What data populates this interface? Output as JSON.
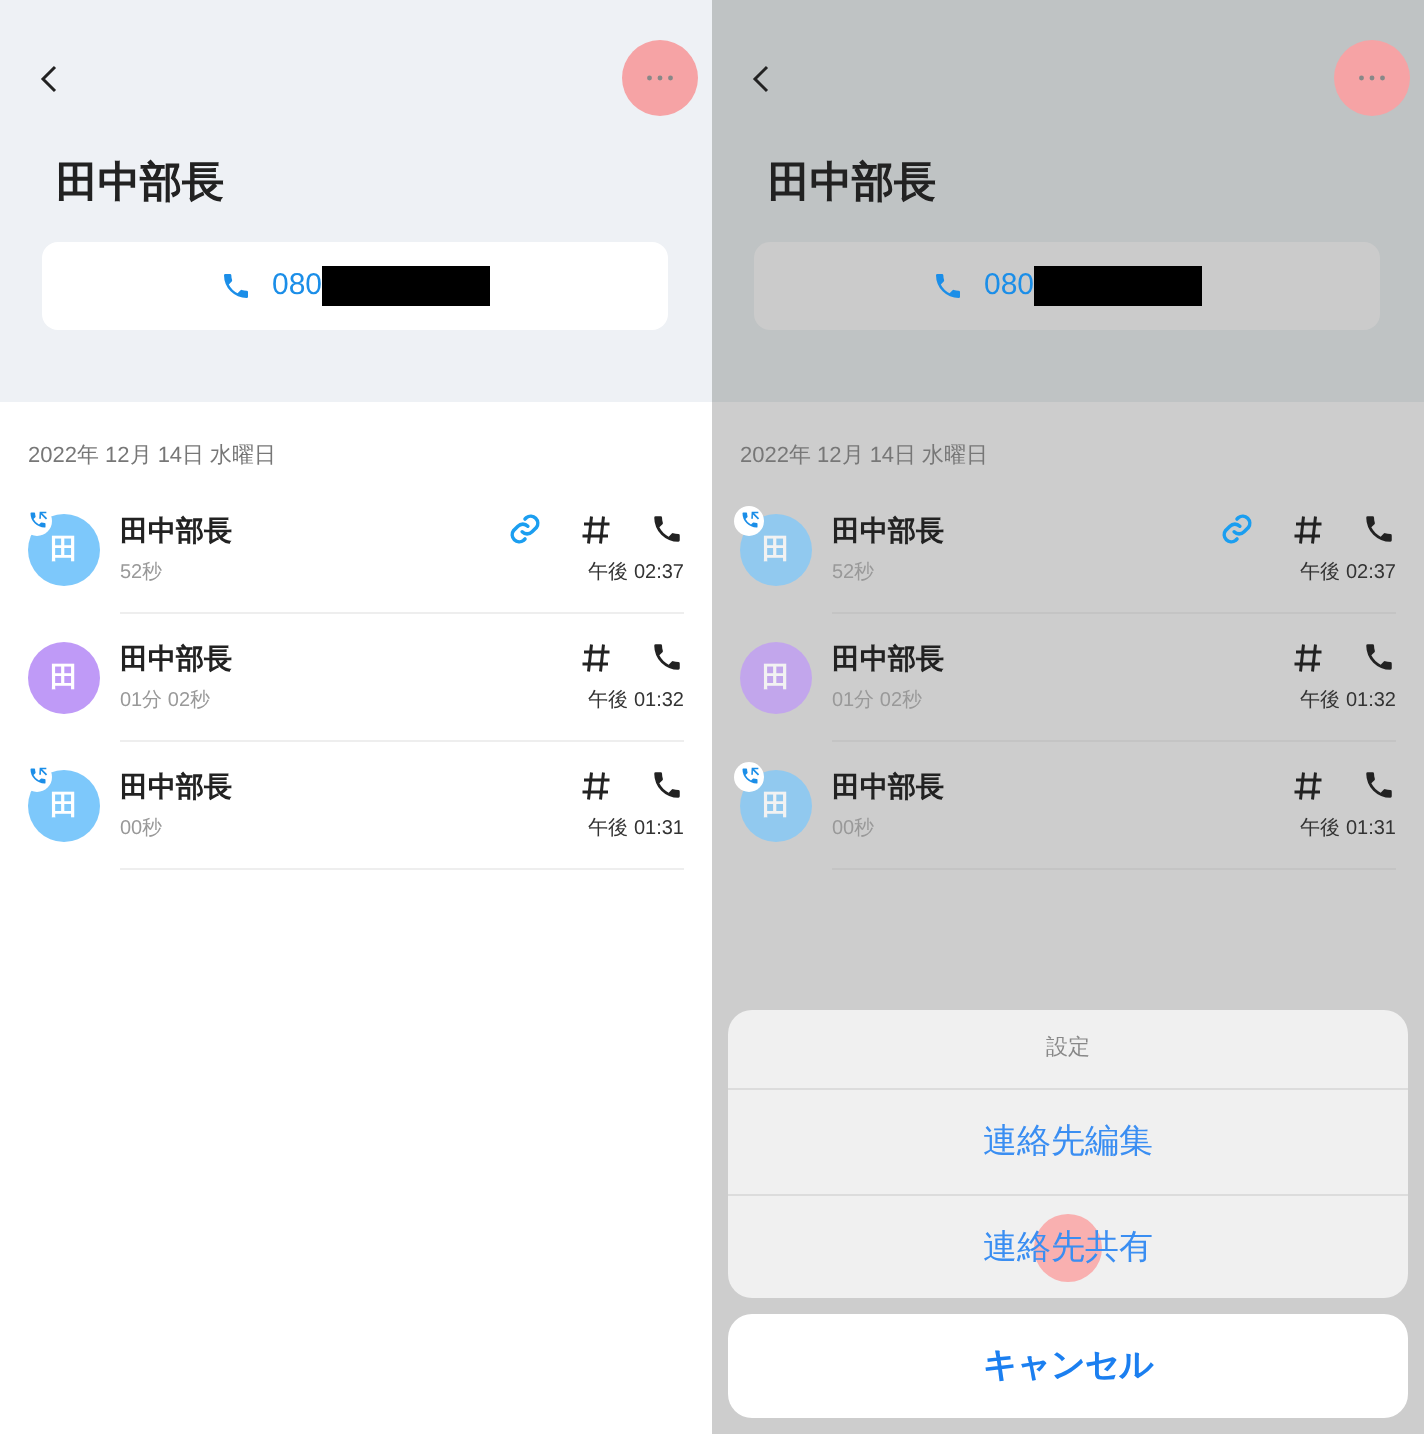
{
  "screens": [
    {
      "dimmed": false,
      "more_touched": true,
      "title": "田中部長",
      "phone": {
        "number": "080",
        "redacted": true
      },
      "date": "2022年 12月 14日 水曜日",
      "calls": [
        {
          "avatar_text": "田",
          "color": "#7dc8fb",
          "badge": true,
          "name": "田中部長",
          "duration": "52秒",
          "linked": true,
          "time": "午後 02:37"
        },
        {
          "avatar_text": "田",
          "color": "#bf9af7",
          "badge": false,
          "name": "田中部長",
          "duration": "01分 02秒",
          "linked": false,
          "time": "午後 01:32"
        },
        {
          "avatar_text": "田",
          "color": "#7dc8fb",
          "badge": true,
          "name": "田中部長",
          "duration": "00秒",
          "linked": false,
          "time": "午後 01:31"
        }
      ]
    },
    {
      "dimmed": true,
      "more_touched": true,
      "title": "田中部長",
      "phone": {
        "number": "080",
        "redacted": true
      },
      "date": "2022年 12月 14日 水曜日",
      "calls": [
        {
          "avatar_text": "田",
          "color": "#7dc8fb",
          "badge": true,
          "name": "田中部長",
          "duration": "52秒",
          "linked": true,
          "time": "午後 02:37"
        },
        {
          "avatar_text": "田",
          "color": "#bf9af7",
          "badge": false,
          "name": "田中部長",
          "duration": "01分 02秒",
          "linked": false,
          "time": "午後 01:32"
        },
        {
          "avatar_text": "田",
          "color": "#7dc8fb",
          "badge": true,
          "name": "田中部長",
          "duration": "00秒",
          "linked": false,
          "time": "午後 01:31"
        }
      ],
      "action_sheet": {
        "title": "設定",
        "items": [
          {
            "label": "連絡先編集",
            "touched": false
          },
          {
            "label": "連絡先共有",
            "touched": true
          }
        ],
        "cancel": "キャンセル"
      }
    }
  ]
}
